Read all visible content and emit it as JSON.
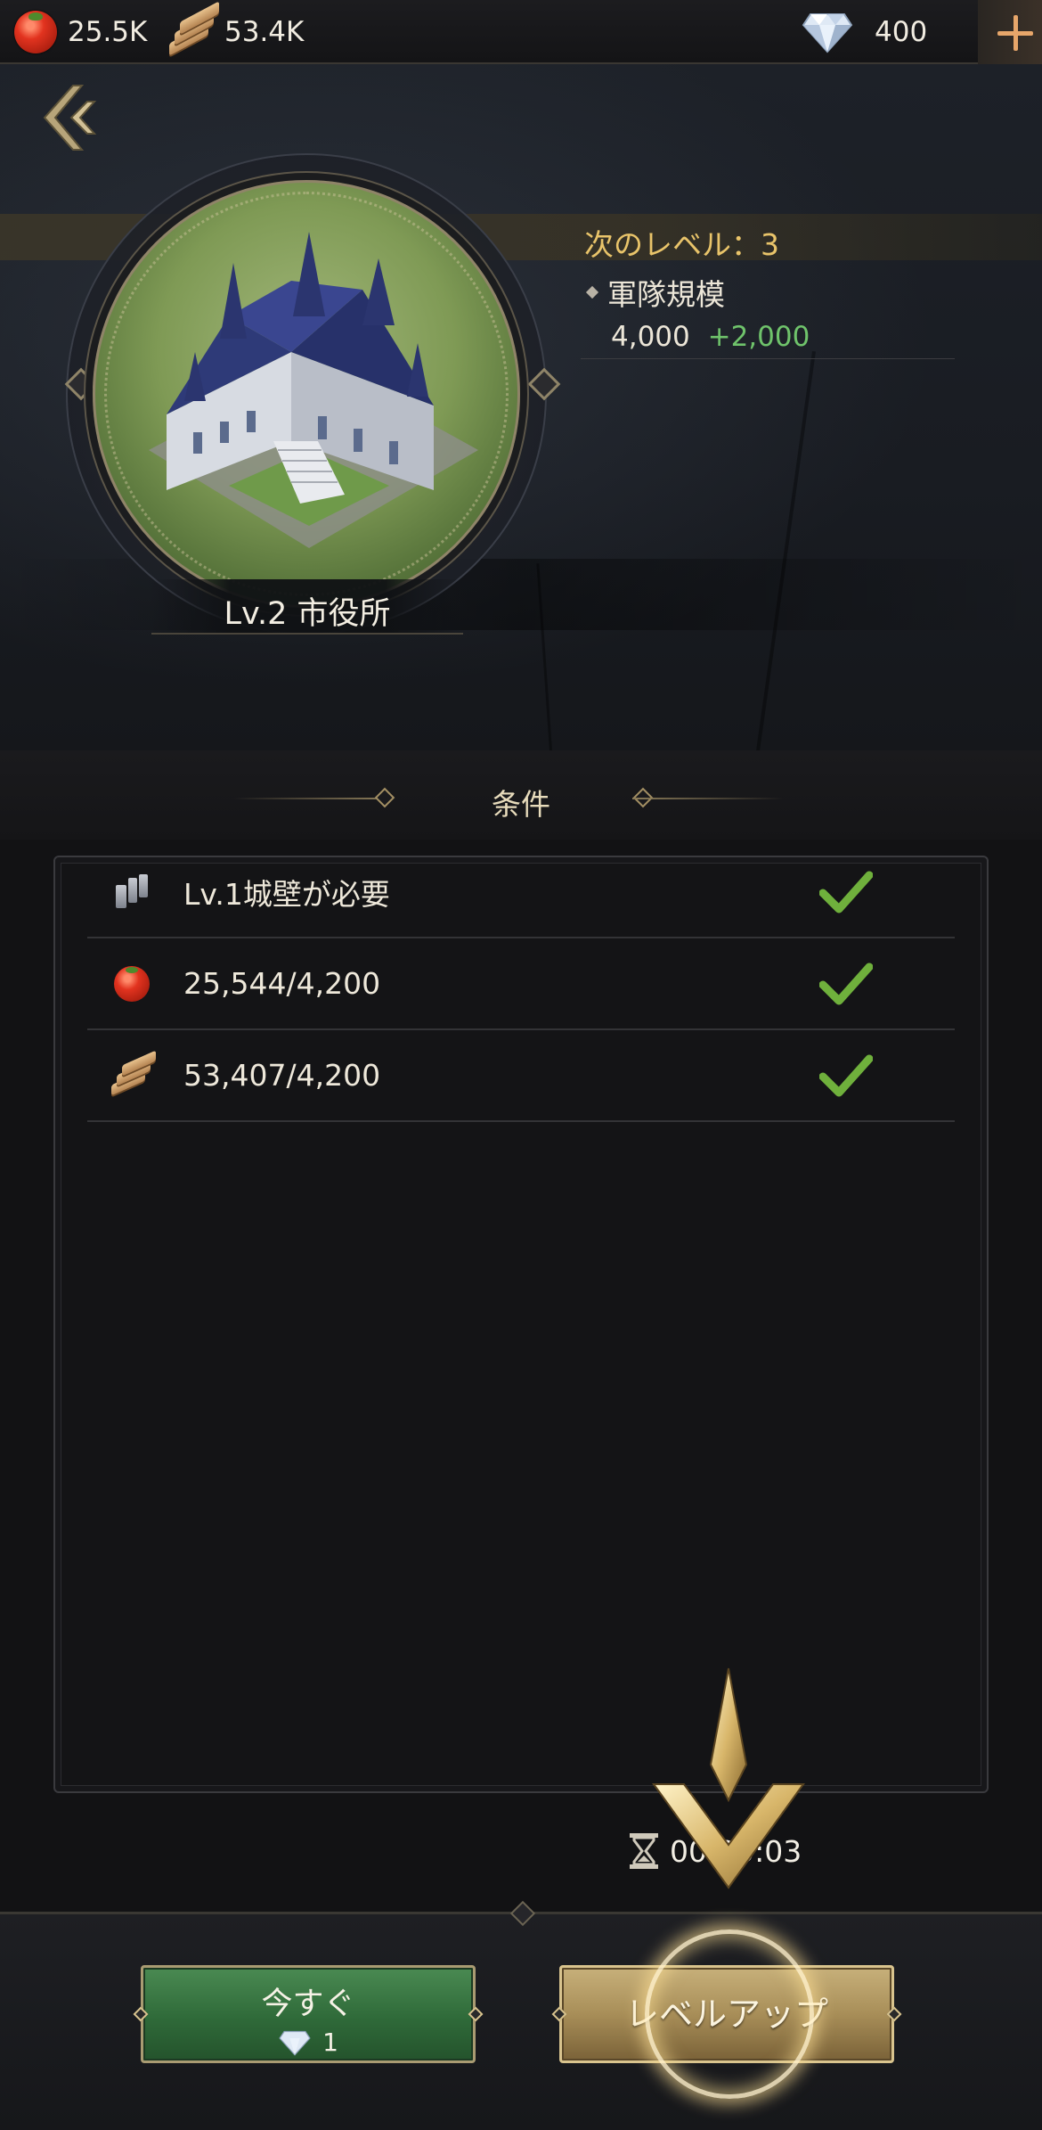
{
  "topbar": {
    "food_value": "25.5K",
    "wood_value": "53.4K",
    "gems_value": "400"
  },
  "header": {
    "next_level_label": "次のレベル：3",
    "stat_name": "軍隊規模",
    "stat_current": "4,000",
    "stat_increase": "+2,000",
    "building_name": "Lv.2 市役所"
  },
  "conditions": {
    "title": "条件",
    "rows": [
      {
        "icon": "wall-icon",
        "text": "Lv.1城壁が必要",
        "met": true
      },
      {
        "icon": "food-icon",
        "text": "25,544/4,200",
        "met": true
      },
      {
        "icon": "wood-icon",
        "text": "53,407/4,200",
        "met": true
      }
    ]
  },
  "timer": {
    "value": "00:00:03"
  },
  "buttons": {
    "instant_label": "今すぐ",
    "instant_cost": "1",
    "upgrade_label": "レベルアップ"
  },
  "colors": {
    "accent_gold": "#e9c46a",
    "increase_green": "#6fc36b",
    "check_green": "#6fb03c",
    "instant_button": "#2f6a39",
    "upgrade_button": "#a88e58"
  }
}
